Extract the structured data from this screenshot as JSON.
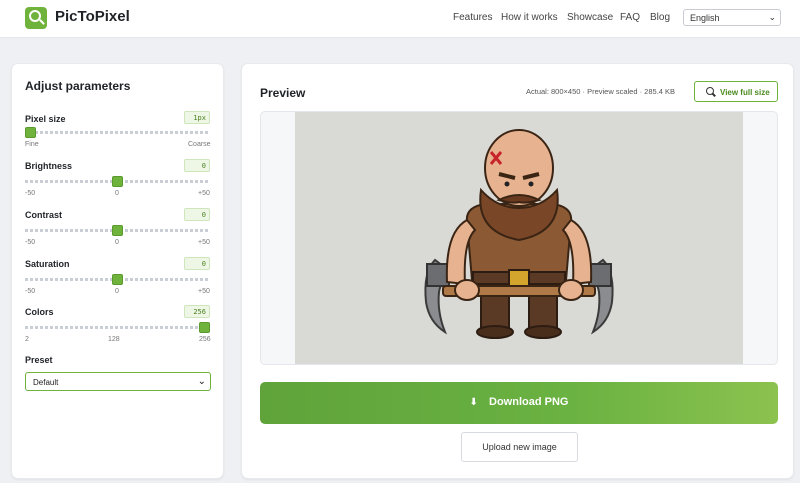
{
  "app": {
    "brand": "PicToPixel"
  },
  "nav": {
    "items": [
      "Features",
      "How it works",
      "Showcase",
      "FAQ",
      "Blog"
    ],
    "language": "English"
  },
  "params": {
    "title": "Adjust parameters",
    "pixel_size": {
      "label": "Pixel size",
      "value": "1px",
      "min_label": "Fine",
      "max_label": "Coarse",
      "level": 0.0
    },
    "brightness": {
      "label": "Brightness",
      "value": "0",
      "min": "-50",
      "mid": "0",
      "max": "+50",
      "level": 0.5
    },
    "contrast": {
      "label": "Contrast",
      "value": "0",
      "min": "-50",
      "mid": "0",
      "max": "+50",
      "level": 0.5
    },
    "saturation": {
      "label": "Saturation",
      "value": "0",
      "min": "-50",
      "mid": "0",
      "max": "+50",
      "level": 0.5
    },
    "colors": {
      "label": "Colors",
      "value": "256",
      "min": "2",
      "mid": "128",
      "max": "256",
      "level": 1.0
    },
    "preset": {
      "label": "Preset",
      "value": "Default"
    }
  },
  "preview": {
    "title": "Preview",
    "meta": "Actual: 800×450 · Preview scaled · 285.4 KB",
    "view_full_size": "View full size",
    "download": "Download PNG",
    "upload": "Upload new image"
  },
  "colors": {
    "accent": "#6fb23c",
    "background": "#eef0f3"
  }
}
